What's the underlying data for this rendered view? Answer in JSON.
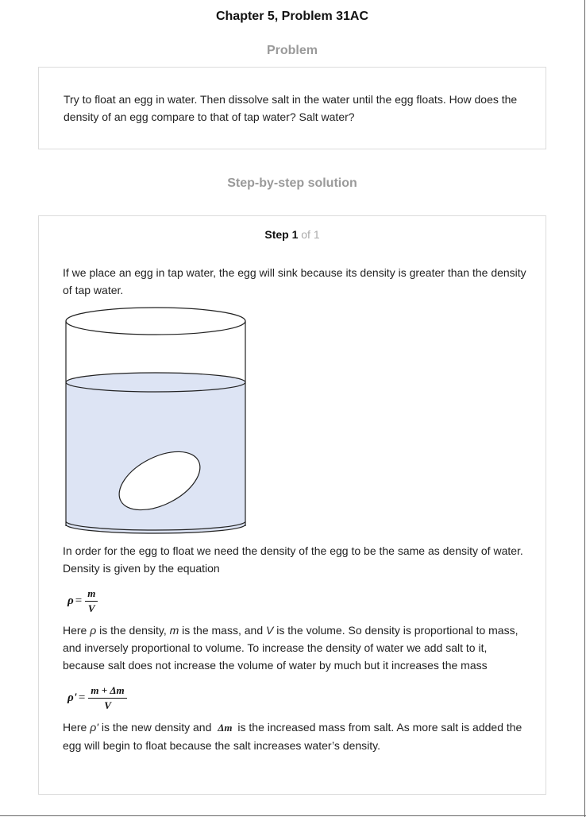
{
  "header": {
    "chapter_title": "Chapter 5, Problem 31AC",
    "problem_heading": "Problem",
    "solution_heading": "Step-by-step solution"
  },
  "problem": {
    "text": "Try to float an egg in water. Then dissolve salt in the water until the egg floats. How does the density of an egg compare to that of tap water? Salt water?"
  },
  "step": {
    "label_word": "Step 1",
    "label_of": " of 1",
    "para1": "If we place an egg in tap water, the egg will sink because its density is greater than the density of tap water.",
    "para2": "In order for the egg to float we need the density of the egg to be the same as density of water. Density is given by the equation",
    "formula1": {
      "lhs": "ρ",
      "eq": "=",
      "num": "m",
      "den": "V"
    },
    "para3": {
      "t1": "Here ",
      "rho": "ρ",
      "t2": " is the density, ",
      "m": "m",
      "t3": " is the mass, and ",
      "v": "V",
      "t4": " is the volume. So density is proportional to mass, and inversely proportional to volume. To increase the density of water we add salt to it, because salt does not increase the volume of water by much but it increases the mass"
    },
    "formula2": {
      "lhs": "ρ'",
      "eq": "=",
      "num": "m + Δm",
      "den": "V"
    },
    "para4": {
      "t1": "Here ",
      "rho_prime": "ρ'",
      "t2": " is the new density and ",
      "delta_m": "Δm",
      "t3": " is the increased mass from salt. As more salt is added the egg will begin to float because the salt increases water’s density."
    }
  },
  "colors": {
    "water": "#dde4f4",
    "heading_gray": "#9a9a9a",
    "box_border": "#dcdcdc"
  }
}
